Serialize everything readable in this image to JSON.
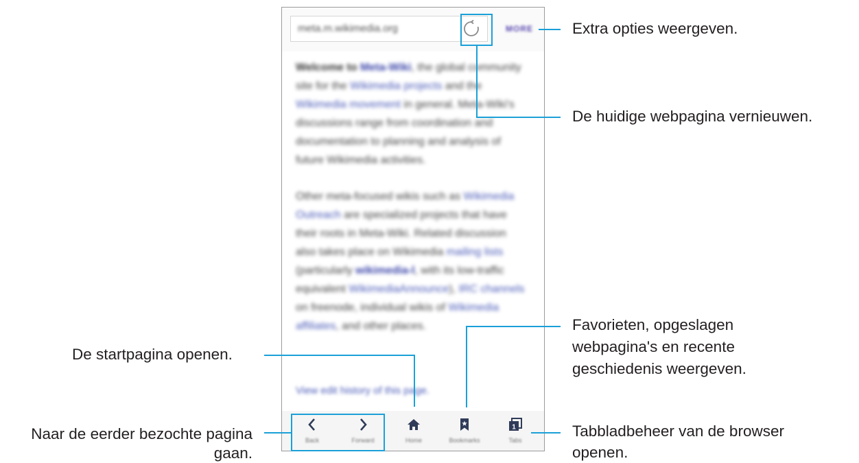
{
  "browser": {
    "url": "meta.m.wikimedia.org",
    "more_label": "MORE",
    "paragraphs": [
      [
        {
          "t": "Welcome to ",
          "s": "b"
        },
        {
          "t": "Meta-Wiki",
          "s": "lkb"
        },
        {
          "t": ", the global community site for the ",
          "s": ""
        },
        {
          "t": "Wikimedia projects",
          "s": "lk"
        },
        {
          "t": " and the ",
          "s": ""
        },
        {
          "t": "Wikimedia movement",
          "s": "lk"
        },
        {
          "t": " in general. Meta-Wiki's discussions range from coordination and documentation to planning and analysis of future Wikimedia activities.",
          "s": ""
        }
      ],
      [
        {
          "t": "Other meta-focused wikis such as ",
          "s": ""
        },
        {
          "t": "Wikimedia Outreach",
          "s": "lk"
        },
        {
          "t": " are specialized projects that have their roots in Meta-Wiki. Related discussion also takes place on Wikimedia ",
          "s": ""
        },
        {
          "t": "mailing lists",
          "s": "lk"
        },
        {
          "t": " (particularly ",
          "s": ""
        },
        {
          "t": "wikimedia-l",
          "s": "lkb"
        },
        {
          "t": ", with its low-traffic equivalent ",
          "s": ""
        },
        {
          "t": "WikimediaAnnounce",
          "s": "lk"
        },
        {
          "t": "), ",
          "s": ""
        },
        {
          "t": "IRC channels",
          "s": "lk"
        },
        {
          "t": " on freenode, individual wikis of ",
          "s": ""
        },
        {
          "t": "Wikimedia affiliates",
          "s": "lk"
        },
        {
          "t": ", and other places.",
          "s": ""
        }
      ]
    ],
    "footer_link": "View edit history of this page.",
    "toolbar": [
      {
        "label": "Back",
        "icon": "chevron-left-icon"
      },
      {
        "label": "Forward",
        "icon": "chevron-right-icon"
      },
      {
        "label": "Home",
        "icon": "home-icon"
      },
      {
        "label": "Bookmarks",
        "icon": "bookmark-icon"
      },
      {
        "label": "Tabs",
        "icon": "tabs-icon",
        "count": "1"
      }
    ]
  },
  "callouts": {
    "more": "Extra opties weergeven.",
    "refresh": "De huidige webpagina vernieuwen.",
    "bookmarks_line1": "Favorieten, opgeslagen",
    "bookmarks_line2": "webpagina's en recente",
    "bookmarks_line3": "geschiedenis weergeven.",
    "home": "De startpagina openen.",
    "backforward_line1": "Naar de eerder bezochte pagina",
    "backforward_line2": "gaan.",
    "tabs_line1": "Tabbladbeheer van de browser",
    "tabs_line2": "openen."
  },
  "colors": {
    "callout": "#1aa0d8",
    "link": "#4a5ab8",
    "more": "#5a4ab0"
  }
}
